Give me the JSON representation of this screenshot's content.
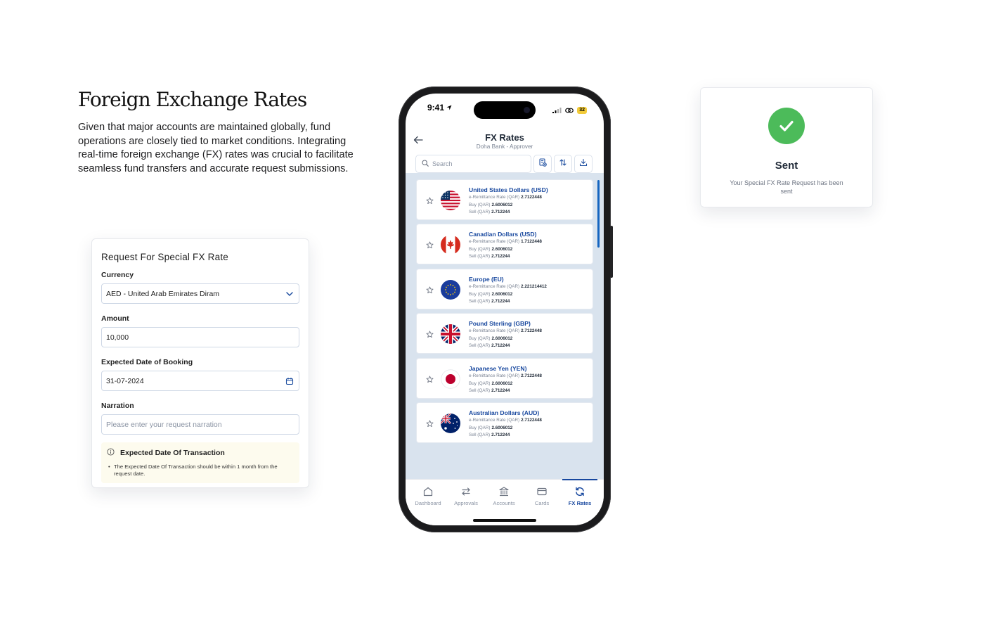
{
  "intro": {
    "title": "Foreign Exchange Rates",
    "body": "Given that major accounts are maintained globally, fund operations are closely tied to market conditions. Integrating real-time foreign exchange (FX) rates was crucial to facilitate seamless fund transfers and accurate request submissions."
  },
  "form": {
    "title": "Request For Special FX Rate",
    "currency_label": "Currency",
    "currency_value": "AED - United Arab Emirates Diram",
    "amount_label": "Amount",
    "amount_value": "10,000",
    "date_label": "Expected Date of Booking",
    "date_value": "31-07-2024",
    "narration_label": "Narration",
    "narration_placeholder": "Please enter your request narration",
    "info_title": "Expected Date Of Transaction",
    "info_text": "The Expected Date Of Transaction should be within 1 month from the request date."
  },
  "sent": {
    "title": "Sent",
    "subtitle": "Your Special FX Rate Request has been sent"
  },
  "phone": {
    "status": {
      "time": "9:41",
      "battery": "32"
    },
    "header": {
      "title": "FX Rates",
      "subtitle": "Doha Bank - Approver"
    },
    "search_placeholder": "Search",
    "labels": {
      "remit": "e-Remittance Rate (QAR)",
      "buy": "Buy (QAR)",
      "sell": "Sell (QAR)"
    },
    "rates": [
      {
        "name": "United States Dollars (USD)",
        "flag": "us-flag",
        "remit": "2.7122448",
        "buy": "2.6006012",
        "sell": "2.712244"
      },
      {
        "name": "Canadian Dollars (USD)",
        "flag": "canada-flag",
        "remit": "1.7122448",
        "buy": "2.6006012",
        "sell": "2.712244"
      },
      {
        "name": "Europe (EU)",
        "flag": "eu-flag",
        "remit": "2.221214412",
        "buy": "2.6006012",
        "sell": "2.712244"
      },
      {
        "name": "Pound Sterling (GBP)",
        "flag": "uk-flag",
        "remit": "2.7122448",
        "buy": "2.6006012",
        "sell": "2.712244"
      },
      {
        "name": "Japanese Yen (YEN)",
        "flag": "japan-flag",
        "remit": "2.7122448",
        "buy": "2.6006012",
        "sell": "2.712244"
      },
      {
        "name": "Australian Dollars (AUD)",
        "flag": "australia-flag",
        "remit": "2.7122448",
        "buy": "2.6006012",
        "sell": "2.712244"
      }
    ],
    "tabs": [
      {
        "label": "Dashboard",
        "icon": "home-icon"
      },
      {
        "label": "Approvals",
        "icon": "swap-icon"
      },
      {
        "label": "Accounts",
        "icon": "bank-icon"
      },
      {
        "label": "Cards",
        "icon": "card-icon"
      },
      {
        "label": "FX Rates",
        "icon": "refresh-icon",
        "active": true
      }
    ]
  },
  "colors": {
    "brand_blue": "#17479e",
    "success_green": "#4cbb5a",
    "list_background": "#d9e3ee",
    "info_background": "#fdfbee"
  }
}
